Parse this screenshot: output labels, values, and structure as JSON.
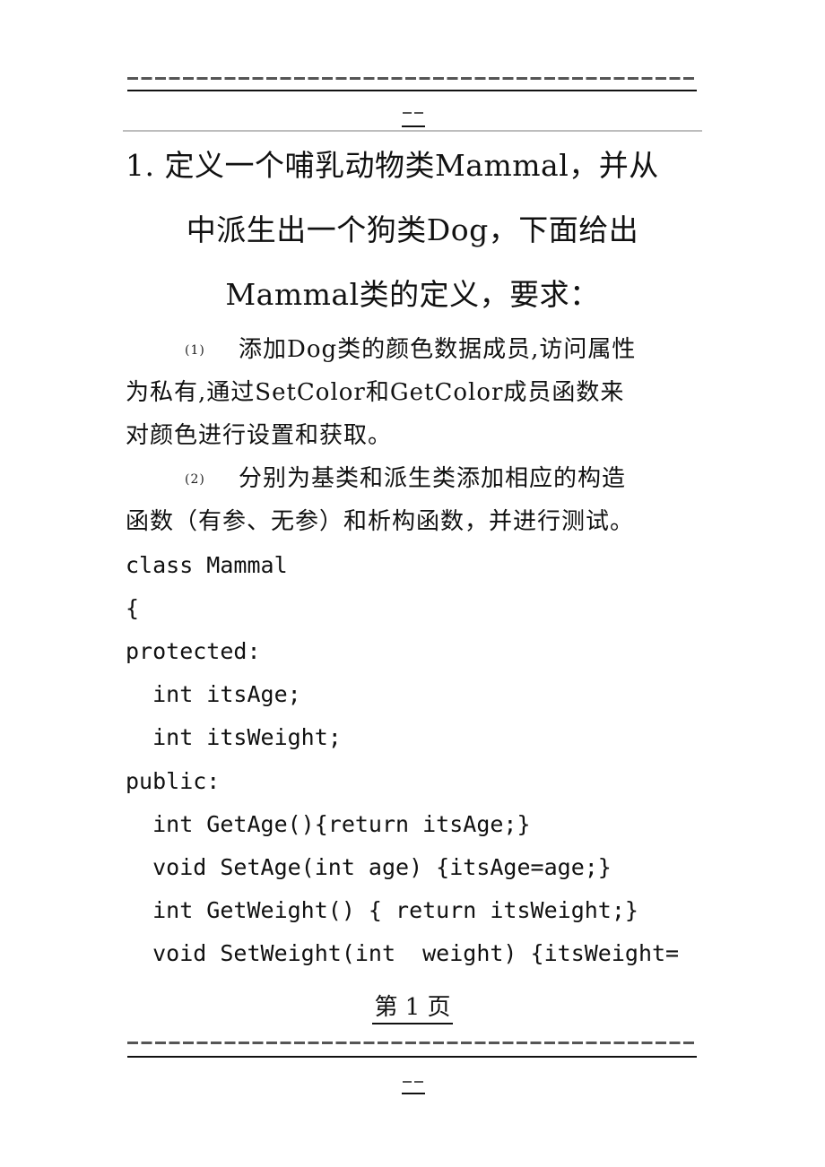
{
  "header": {
    "dash_line": "-----------------------------------------",
    "mini_dash": "--"
  },
  "question": {
    "title_lines": [
      "1.  定义一个哺乳动物类Mammal，并从",
      "中派生出一个狗类Dog，下面给出",
      "Mammal类的定义，要求："
    ],
    "requirements": [
      {
        "marker": "(1)",
        "lines": [
          "添加Dog类的颜色数据成员,访问属性",
          "为私有,通过SetColor和GetColor成员函数来",
          "对颜色进行设置和获取。"
        ]
      },
      {
        "marker": "(2)",
        "lines": [
          "分别为基类和派生类添加相应的构造",
          "函数（有参、无参）和析构函数，并进行测试。"
        ]
      }
    ]
  },
  "code": {
    "lines": [
      "class Mammal",
      "{",
      "protected:",
      "  int itsAge;",
      "  int itsWeight;",
      "public:",
      "  int GetAge(){return itsAge;}",
      "  void SetAge(int age) {itsAge=age;}",
      "  int GetWeight() { return itsWeight;}",
      "  void SetWeight(int  weight) {itsWeight="
    ]
  },
  "footer": {
    "page_label": "第 1 页",
    "dash_line": "-----------------------------------------",
    "mini_dash": "--"
  }
}
